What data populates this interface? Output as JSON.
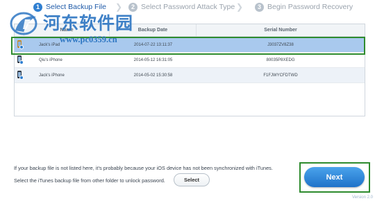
{
  "steps": [
    {
      "num": "1",
      "label": "Select Backup File"
    },
    {
      "num": "2",
      "label": "Select Password Attack Type"
    },
    {
      "num": "3",
      "label": "Begin Password Recovery"
    }
  ],
  "watermark": {
    "title": "河东软件园",
    "url": "www.pc0359.cn"
  },
  "table": {
    "headers": {
      "name": "Name",
      "backup_date": "Backup Date",
      "serial": "Serial Number"
    },
    "rows": [
      {
        "name": "Jack's iPad",
        "date": "2014-07-22 13:11:37",
        "serial": "J3037ZV8Z38"
      },
      {
        "name": "Qiu's iPhone",
        "date": "2014-05-12 16:31:05",
        "serial": "80035P8XEDG"
      },
      {
        "name": "Jack's iPhone",
        "date": "2014-05-02 15:30:58",
        "serial": "F1FJWYCFDTWD"
      }
    ]
  },
  "footer": {
    "line1": "If your backup file is not listed here, it's probably because your iOS device has not been synchronized with iTunes.",
    "line2": "Select the iTunes backup file from other folder to unlock password.",
    "select_label": "Select",
    "next_label": "Next",
    "version": "Version 2.0"
  },
  "colors": {
    "accent": "#2f7fd1",
    "selected_row": "#a9c9ee",
    "highlight_box": "#2e8b2e",
    "watermark": "#2f77c3"
  },
  "icons": {
    "step_arrow": "chevron-right-icon",
    "device": "iphone-icon"
  }
}
